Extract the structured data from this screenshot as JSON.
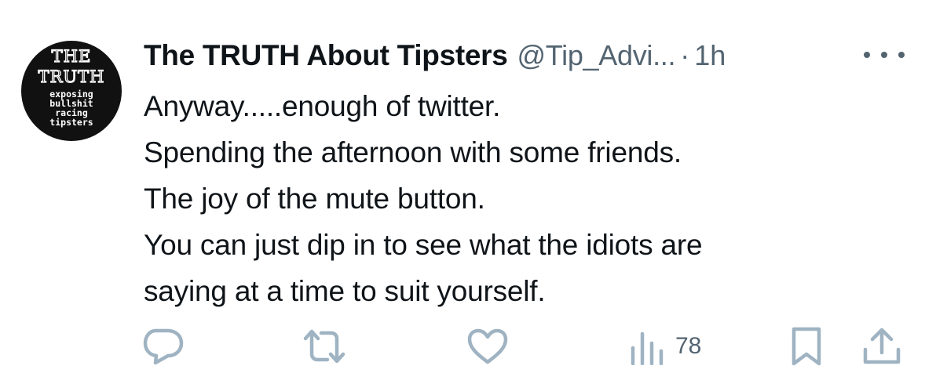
{
  "author": {
    "display_name": "The TRUTH About Tipsters",
    "handle": "@Tip_Advi...",
    "separator": "·",
    "time": "1h",
    "avatar": {
      "logo_lines": [
        "THE",
        "TRUTH",
        "exposing",
        "bullshit",
        "racing",
        "tipsters"
      ]
    }
  },
  "tweet": {
    "lines": [
      "Anyway.....enough of twitter.",
      "Spending the afternoon with some friends.",
      "The joy of the mute button.",
      "You can just dip in to see what the idiots are",
      "saying at a time to suit yourself."
    ]
  },
  "actions": {
    "reply_icon": "reply-icon",
    "retweet_icon": "retweet-icon",
    "like_icon": "like-icon",
    "views_icon": "views-icon",
    "views_count": "78",
    "bookmark_icon": "bookmark-icon",
    "share_icon": "share-icon"
  },
  "colors": {
    "text": "#0f1419",
    "secondary": "#536471",
    "icon": "#9fb3c2",
    "avatar_bg": "#111111"
  }
}
